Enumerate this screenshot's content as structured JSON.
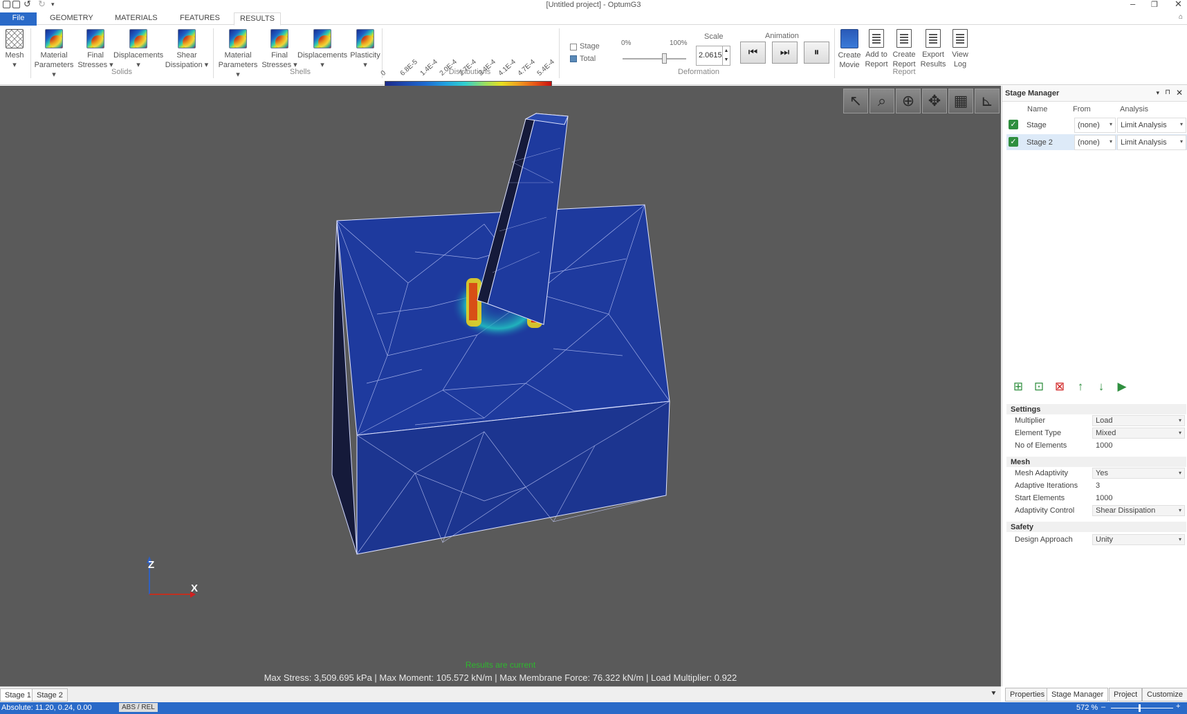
{
  "window": {
    "title": "[Untitled project] - OptumG3"
  },
  "tabs": [
    {
      "label": "File"
    },
    {
      "label": "GEOMETRY"
    },
    {
      "label": "MATERIALS"
    },
    {
      "label": "FEATURES"
    },
    {
      "label": "RESULTS"
    }
  ],
  "ribbon": {
    "mesh": {
      "label": "Mesh"
    },
    "solids": {
      "group": "Solids",
      "items": [
        {
          "label": "Material",
          "label2": "Parameters ▾"
        },
        {
          "label": "Final",
          "label2": "Stresses ▾"
        },
        {
          "label": "Displacements",
          "label2": "▾"
        },
        {
          "label": "Shear",
          "label2": "Dissipation ▾"
        }
      ]
    },
    "shells": {
      "group": "Shells",
      "items": [
        {
          "label": "Material",
          "label2": "Parameters ▾"
        },
        {
          "label": "Final",
          "label2": "Stresses ▾"
        },
        {
          "label": "Displacements",
          "label2": "▾"
        },
        {
          "label": "Plasticity",
          "label2": "▾"
        }
      ]
    },
    "distributions": {
      "group": "Distributions",
      "ticks": [
        "0",
        "6.8E-5",
        "1.4E-4",
        "2.0E-4",
        "2.7E-4",
        "3.4E-4",
        "4.1E-4",
        "4.7E-4",
        "5.4E-4"
      ]
    },
    "stage_total": {
      "stage": "Stage",
      "total": "Total"
    },
    "deformation": {
      "group": "Deformation",
      "min": "0%",
      "max": "100%",
      "scale_label": "Scale",
      "scale_value": "2.0615",
      "slider_fraction": 0.65
    },
    "animation": {
      "label": "Animation",
      "prev": "⏮",
      "next": "⏭",
      "pause": "⏸"
    },
    "report": {
      "group": "Report",
      "items": [
        {
          "label": "Create",
          "label2": "Movie"
        },
        {
          "label": "Add to",
          "label2": "Report"
        },
        {
          "label": "Create",
          "label2": "Report"
        },
        {
          "label": "Export",
          "label2": "Results"
        },
        {
          "label": "View",
          "label2": "Log"
        }
      ]
    }
  },
  "viewport": {
    "status": "Results are current",
    "results": "Max Stress:  3,509.695 kPa | Max Moment:  105.572 kN/m | Max Membrane Force:  76.322 kN/m | Load Multiplier:  0.922",
    "axes": {
      "z": "Z",
      "x": "X"
    }
  },
  "stage_tabs": [
    "Stage 1",
    "Stage 2"
  ],
  "statusbar": {
    "coords": "Absolute: 11.20, 0.24, 0.00",
    "mode": "ABS / REL",
    "zoom": "572 %"
  },
  "stage_manager": {
    "title": "Stage Manager",
    "columns": [
      "Name",
      "From",
      "Analysis"
    ],
    "stages": [
      {
        "name": "Stage",
        "from": "(none)",
        "analysis": "Limit Analysis"
      },
      {
        "name": "Stage 2",
        "from": "(none)",
        "analysis": "Limit Analysis"
      }
    ],
    "settings": {
      "title": "Settings",
      "rows": [
        {
          "key": "Multiplier",
          "value": "Load"
        },
        {
          "key": "Element Type",
          "value": "Mixed"
        },
        {
          "key": "No of Elements",
          "value": "1000"
        }
      ]
    },
    "mesh": {
      "title": "Mesh",
      "rows": [
        {
          "key": "Mesh Adaptivity",
          "value": "Yes"
        },
        {
          "key": "Adaptive Iterations",
          "value": "3"
        },
        {
          "key": "Start Elements",
          "value": "1000"
        },
        {
          "key": "Adaptivity Control",
          "value": "Shear Dissipation"
        }
      ]
    },
    "safety": {
      "title": "Safety",
      "rows": [
        {
          "key": "Design Approach",
          "value": "Unity"
        }
      ]
    },
    "tabs": [
      "Properties",
      "Stage Manager",
      "Project",
      "Customize"
    ]
  },
  "colors": {
    "accent": "#2a6ac8",
    "viewport_bg": "#5a5a5a",
    "mesh_blue": "#1e3a9e",
    "status_green": "#2eb82e"
  }
}
